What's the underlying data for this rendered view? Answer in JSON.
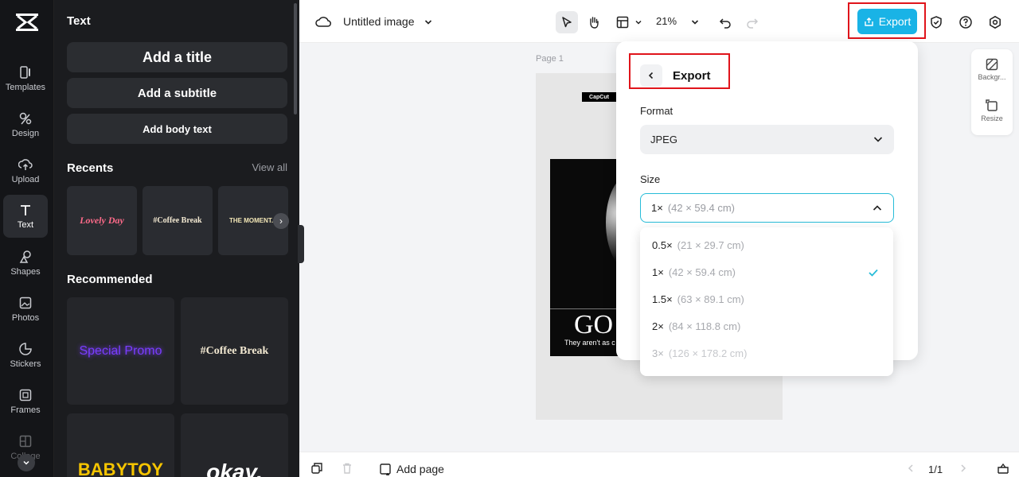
{
  "rail": {
    "items": [
      {
        "label": "Templates",
        "icon": "templates-icon"
      },
      {
        "label": "Design",
        "icon": "design-icon"
      },
      {
        "label": "Upload",
        "icon": "upload-icon"
      },
      {
        "label": "Text",
        "icon": "text-icon",
        "active": true
      },
      {
        "label": "Shapes",
        "icon": "shapes-icon"
      },
      {
        "label": "Photos",
        "icon": "photos-icon"
      },
      {
        "label": "Stickers",
        "icon": "stickers-icon"
      },
      {
        "label": "Frames",
        "icon": "frames-icon"
      },
      {
        "label": "Collage",
        "icon": "collage-icon"
      }
    ]
  },
  "panel": {
    "title": "Text",
    "add_title": "Add a title",
    "add_subtitle": "Add a subtitle",
    "add_body": "Add body text",
    "recents_heading": "Recents",
    "view_all": "View all",
    "recents": [
      "Lovely Day",
      "#Coffee Break",
      "THE MOMENT."
    ],
    "recommended_heading": "Recommended",
    "recommended": [
      "Special Promo",
      "#Coffee Break",
      "BABYTOY",
      "okay."
    ]
  },
  "topbar": {
    "title": "Untitled image",
    "zoom": "21%",
    "export_label": "Export"
  },
  "canvas": {
    "page_label": "Page 1",
    "brand_tag": "CapCut",
    "poster_headline": "GO",
    "poster_caption": "They aren't as c"
  },
  "sidetools": {
    "background_label": "Backgr...",
    "resize_label": "Resize"
  },
  "bottombar": {
    "add_page": "Add page",
    "page_count": "1/1"
  },
  "export": {
    "title": "Export",
    "format_label": "Format",
    "format_value": "JPEG",
    "size_label": "Size",
    "size_value": "1×",
    "size_value_dims": "(42 × 59.4 cm)",
    "options": [
      {
        "scale": "0.5×",
        "dims": "(21 × 29.7 cm)"
      },
      {
        "scale": "1×",
        "dims": "(42 × 59.4 cm)",
        "selected": true
      },
      {
        "scale": "1.5×",
        "dims": "(63 × 89.1 cm)"
      },
      {
        "scale": "2×",
        "dims": "(84 × 118.8 cm)"
      },
      {
        "scale": "3×",
        "dims": "(126 × 178.2 cm)",
        "disabled": true
      }
    ]
  },
  "colors": {
    "accent": "#19b3e6",
    "highlight_box": "#e0141b",
    "panel_bg": "#1b1c1f"
  }
}
